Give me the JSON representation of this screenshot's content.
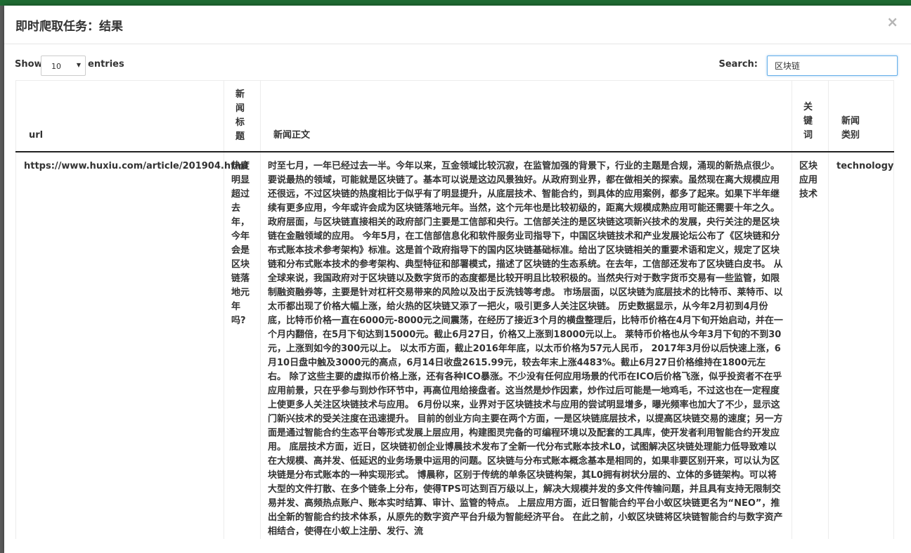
{
  "modal": {
    "title": "即时爬取任务：结果",
    "close": "×"
  },
  "controls": {
    "show_label": "Show",
    "length_value": "10",
    "entries_label": "entries",
    "search_label": "Search:",
    "search_value": "区块链"
  },
  "table": {
    "headers": {
      "url": "url",
      "title": "新闻标题",
      "body": "新闻正文",
      "keyword": "关键词",
      "type": "新闻类别"
    },
    "rows": [
      {
        "url": "https://www.huxiu.com/article/201904.html",
        "title": "热度明显超过去年，今年会是区块链落地元年吗?",
        "body": "时至七月，一年已经过去一半。今年以来，互金领域比较沉寂，在监管加强的背景下，行业的主题是合规，涌现的新热点很少。 要说最热的领域，可能就是区块链了。基本可以说是这边风景独好。从政府到业界，都在做相关的探索。虽然现在离大规模应用还很远，不过区块链的热度相比于似乎有了明显提升，从底层技术、智能合约，到具体的应用案例，都多了起来。如果下半年继续有更多应用，今年或许会成为区块链落地元年。当然，这个元年也是比较初级的，距离大规模成熟应用可能还需要十年之久。 政府层面，与区块链直接相关的政府部门主要是工信部和央行。工信部关注的是区块链这项新兴技术的发展，央行关注的是区块链在金融领域的应用。 今年5月，在工信部信息化和软件服务业司指导下，中国区块链技术和产业发展论坛公布了《区块链和分布式账本技术参考架构》标准。这是首个政府指导下的国内区块链基础标准。给出了区块链相关的重要术语和定义，规定了区块链和分布式账本技术的参考架构、典型特征和部署模式，描述了区块链的生态系统。在去年，工信部还发布了区块链白皮书。 从全球来说，我国政府对于区块链以及数字货币的态度都是比较开明且比较积极的。当然央行对于数字货币交易有一些监管，如限制融资融券等，主要是针对杠杆交易带来的风险以及出于反洗钱等考虑。 市场层面，以区块链为底层技术的比特币、莱特币、以太币都出现了价格大幅上涨，给火热的区块链又添了一把火，吸引更多人关注区块链。 历史数据显示，从今年2月初到4月份底，比特币价格一直在6000元-8000元之间震荡，在经历了接近3个月的横盘整理后，比特币价格在4月下旬开始启动，并在一个月内翻倍，在5月下旬达到15000元。截止6月27日，价格又上涨到18000元以上。 莱特币价格也从今年3月下旬的不到30元，上涨到如今的300元以上。 以太币方面，截止2016年年底，以太币价格为57元人民币， 2017年3月份以后快速上涨，6月10日盘中触及3000元的高点，6月14日收盘2615.99元，较去年末上涨4483%。截止6月27日价格维持在1800元左右。 除了这些主要的虚拟币价格上涨，还有各种ICO暴涨。不少没有任何应用场景的代币在ICO后价格飞涨，似乎投资者不在乎应用前景，只在乎参与到炒作环节中，再高位甩给接盘者。这当然是炒作因素，炒作过后可能是一地鸡毛，不过这也在一定程度上使更多人关注区块链技术与应用。 6月份以来，业界对于区块链技术与应用的尝试明显增多，曝光频率也加大了不少，显示这门新兴技术的受关注度在迅速提升。 目前的创业方向主要在两个方面，一是区块链底层技术，以提高区块链交易的速度；另一方面是通过智能合约生态平台等形式发展上层应用，构建图灵完备的可编程环境以及配套的工具库，使开发者利用智能合约开发应用。 底层技术方面，近日，区块链初创企业博晨技术发布了全新一代分布式账本技术L0，试图解决区块链处理能力低导致难以在大规模、高并发、低延迟的业务场景中运用的问题。区块链与分布式账本概念基本是相同的，如果非要区别开来，可以认为区块链是分布式账本的一种实现形式。 博晨称，区别于传统的单条区块链构架，其L0拥有树状分层的、立体的多链架构。可以将大型的文件打散、在多个链条上分布，使得TPS可达到百万级以上，解决大规模并发的多文件传输问题，并且具有支持无限制交易并发、高频热点账户、账本实时结算、审计、监管的特点。 上层应用方面，近日智能合约平台小蚁区块链更名为“NEO”，推出全新的智能合约技术体系，从原先的数字资产平台升级为智能经济平台。 在此之前，小蚁区块链将区块链智能合约与数字资产相结合，使得在小蚁上注册、发行、流",
        "keyword": "区块应用技术",
        "type": "technology"
      }
    ]
  },
  "colors": {
    "topbar": "#1f6b33",
    "search_border": "#66afe9",
    "header_rule": "#222222"
  }
}
